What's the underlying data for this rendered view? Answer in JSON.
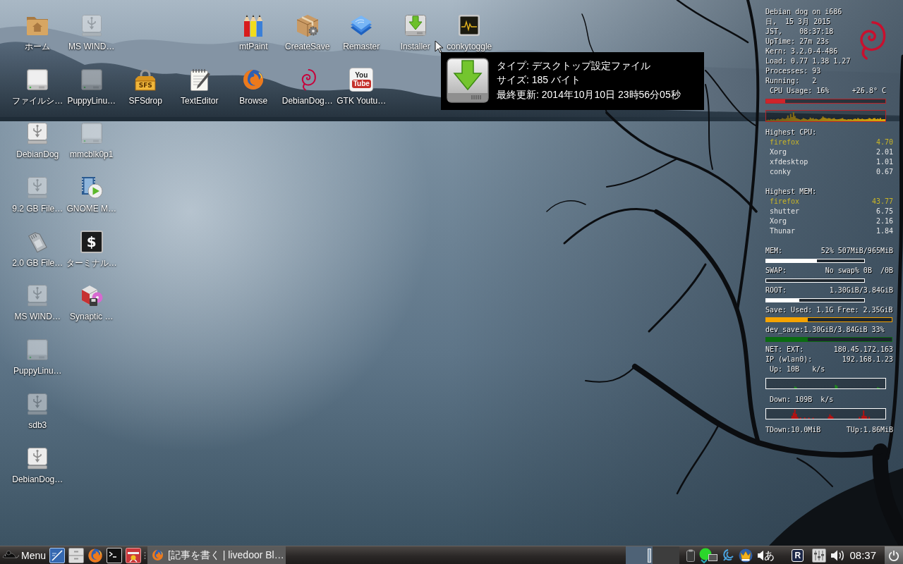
{
  "desktop_icons": [
    {
      "label": "ホーム",
      "kind": "folder"
    },
    {
      "label": "MS WIND…",
      "kind": "usb",
      "mounted": false
    },
    {
      "label": "mtPaint",
      "kind": "pencils"
    },
    {
      "label": "CreateSave",
      "kind": "package"
    },
    {
      "label": "Remaster",
      "kind": "layers"
    },
    {
      "label": "Installer",
      "kind": "installer"
    },
    {
      "label": "conkytoggle",
      "kind": "monitor"
    },
    {
      "label": "ファイルシ…",
      "kind": "drive",
      "mounted": true
    },
    {
      "label": "PuppyLinu…",
      "kind": "drive",
      "mounted": false
    },
    {
      "label": "SFSdrop",
      "kind": "padlock",
      "icon_text": [
        "SFS"
      ]
    },
    {
      "label": "TextEditor",
      "kind": "notepad"
    },
    {
      "label": "Browse",
      "kind": "firefox"
    },
    {
      "label": "DebianDog…",
      "kind": "swirl"
    },
    {
      "label": "GTK Youtu…",
      "kind": "video",
      "icon_text": [
        "You",
        "Tube"
      ]
    },
    {
      "label": "DebianDog",
      "kind": "usb",
      "mounted": true
    },
    {
      "label": "mmcblk0p1",
      "kind": "drive",
      "mounted": false
    },
    {
      "label": "9.2 GB File…",
      "kind": "usb",
      "mounted": false
    },
    {
      "label": "GNOME M…",
      "kind": "player"
    },
    {
      "label": "2.0 GB File…",
      "kind": "card"
    },
    {
      "label": "ターミナル…",
      "kind": "terminal",
      "icon_text": [
        "$"
      ]
    },
    {
      "label": "MS WIND…",
      "kind": "usb",
      "mounted": false
    },
    {
      "label": "Synaptic …",
      "kind": "synaptic"
    },
    {
      "label": "PuppyLinu…",
      "kind": "drive",
      "mounted": false
    },
    {
      "label": "sdb3",
      "kind": "usb",
      "mounted": false
    },
    {
      "label": "DebianDog…",
      "kind": "usb",
      "mounted": true
    }
  ],
  "tooltip": {
    "lines": [
      "タイプ: デスクトップ設定ファイル",
      "サイズ: 185 バイト",
      "最終更新: 2014年10月10日 23時56分05秒"
    ]
  },
  "conky": {
    "info_lines": [
      "Debian dog on i686",
      "日,  15 3月 2015",
      "JST,    08:37:18",
      "UpTime: 27m 23s",
      "Kern: 3.2.0-4-486",
      "Load: 0.77 1.38 1.27",
      "Processes: 93",
      "Running:   2"
    ],
    "cpu": {
      "label": "CPU Usage: 16%",
      "temperature": "+26.8° C",
      "level": 0.16
    },
    "process_lists": [
      {
        "title": "Highest CPU:",
        "processes": [
          {
            "name": "firefox",
            "value": "4.70",
            "color": "#c9b527"
          },
          {
            "name": "Xorg",
            "value": "2.01",
            "color": "#e6e6e6"
          },
          {
            "name": "xfdesktop",
            "value": "1.01",
            "color": "#e6e6e6"
          },
          {
            "name": "conky",
            "value": "0.67",
            "color": "#e6e6e6"
          }
        ]
      },
      {
        "title": "Highest MEM:",
        "processes": [
          {
            "name": "firefox",
            "value": "43.77",
            "color": "#c9b527"
          },
          {
            "name": "shutter",
            "value": "6.75",
            "color": "#e6e6e6"
          },
          {
            "name": "Xorg",
            "value": "2.16",
            "color": "#e6e6e6"
          },
          {
            "name": "Thunar",
            "value": "1.84",
            "color": "#e6e6e6"
          }
        ]
      }
    ],
    "meters": [
      {
        "kind": "usage",
        "label": "MEM:",
        "reading": "52% 507MiB/965MiB",
        "level": 0.52,
        "color": "#ffffff"
      },
      {
        "kind": "usage",
        "label": "SWAP:",
        "reading": "No swap% 0B  /0B",
        "color": "#ffffff"
      },
      {
        "kind": "usage",
        "label": "ROOT:",
        "reading": "1.30GiB/3.84GiB",
        "level": 0.34,
        "color": "#ffffff"
      },
      {
        "kind": "partition",
        "label": "Save: Used: 1.1G Free: 2.35GiB",
        "level": 0.33,
        "color": "#f5a300"
      },
      {
        "kind": "partition",
        "label": "dev_save:1.30GiB/3.84GiB 33%",
        "level": 0.33,
        "color": "#0b6b12"
      }
    ],
    "network": {
      "addresses": [
        {
          "label": "NET: EXT:",
          "value": "180.45.172.163"
        },
        {
          "label": "IP (wlan0):",
          "value": "192.168.1.23"
        }
      ],
      "up": "Up: 10B   k/s",
      "down": "Down: 109B  k/s",
      "total_down": "TDown:10.0MiB",
      "total_up": "TUp:1.86MiB"
    }
  },
  "taskbar": {
    "menu": {
      "label": "Menu"
    },
    "launchers": [
      {
        "kind": "desktop"
      },
      {
        "kind": "cabinet"
      },
      {
        "kind": "firefox"
      },
      {
        "kind": "terminal"
      },
      {
        "kind": "toolbox"
      }
    ],
    "tasks": [
      {
        "title": "[記事を書く | livedoor Bl…",
        "selected": false
      }
    ],
    "workspaces": [
      {
        "selected": true,
        "has_window": true
      },
      {
        "selected": false,
        "has_window": false
      }
    ],
    "tray": [
      {
        "kind": "clipboard"
      },
      {
        "kind": "network"
      },
      {
        "kind": "swirl"
      },
      {
        "kind": "crown"
      },
      {
        "kind": "ime",
        "text": "あ"
      },
      {
        "kind": "letter",
        "text": "R"
      },
      {
        "kind": "mixer"
      },
      {
        "kind": "volume"
      }
    ],
    "clock": "08:37"
  }
}
